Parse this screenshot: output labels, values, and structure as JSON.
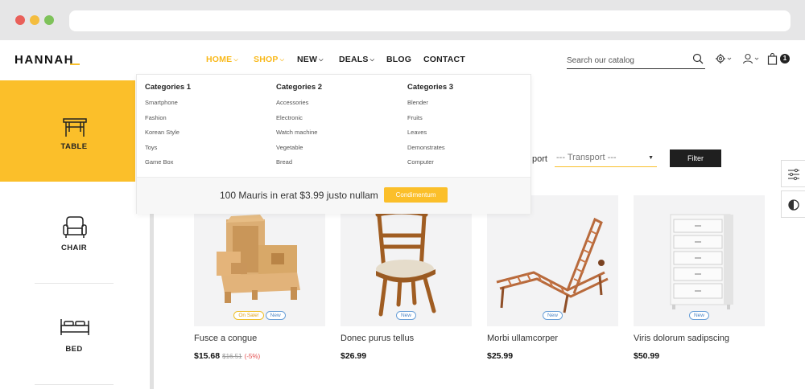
{
  "site": {
    "logo": "HANNAH"
  },
  "nav": [
    {
      "label": "HOME",
      "caret": true,
      "active": true
    },
    {
      "label": "SHOP",
      "caret": true,
      "active": true
    },
    {
      "label": "NEW",
      "caret": true,
      "active": false
    },
    {
      "label": "DEALS",
      "caret": true,
      "active": false
    },
    {
      "label": "BLOG",
      "caret": false,
      "active": false
    },
    {
      "label": "CONTACT",
      "caret": false,
      "active": false
    }
  ],
  "search": {
    "placeholder": "Search our catalog"
  },
  "cart": {
    "count": "1"
  },
  "sidebar": {
    "items": [
      {
        "label": "TABLE",
        "icon": "table-icon",
        "active": true
      },
      {
        "label": "CHAIR",
        "icon": "armchair-icon",
        "active": false
      },
      {
        "label": "BED",
        "icon": "bed-icon",
        "active": false
      }
    ]
  },
  "mega_menu": {
    "columns": [
      {
        "title": "Categories 1",
        "links": [
          "Smartphone",
          "Fashion",
          "Korean Style",
          "Toys",
          "Game Box"
        ]
      },
      {
        "title": "Categories 2",
        "links": [
          "Accessories",
          "Electronic",
          "Watch machine",
          "Vegetable",
          "Bread"
        ]
      },
      {
        "title": "Categories 3",
        "links": [
          "Blender",
          "Fruits",
          "Leaves",
          "Demonstrates",
          "Computer"
        ]
      }
    ],
    "promo_text": "100 Mauris in erat $3.99 justo nullam",
    "promo_button": "Condimentum"
  },
  "filter": {
    "label": "port",
    "select_value": "--- Transport ---",
    "button": "Filter"
  },
  "products": [
    {
      "name": "Fusce a congue",
      "price": "$15.68",
      "old_price": "$16.51",
      "discount": "(-5%)",
      "badges": [
        "On Sale!",
        "New"
      ],
      "image": "armchair"
    },
    {
      "name": "Donec purus tellus",
      "price": "$26.99",
      "old_price": "",
      "discount": "",
      "badges": [
        "New"
      ],
      "image": "chair"
    },
    {
      "name": "Morbi ullamcorper",
      "price": "$25.99",
      "old_price": "",
      "discount": "",
      "badges": [
        "New"
      ],
      "image": "lounger"
    },
    {
      "name": "Viris dolorum sadipscing",
      "price": "$50.99",
      "old_price": "",
      "discount": "",
      "badges": [
        "New"
      ],
      "image": "dresser"
    }
  ],
  "colors": {
    "accent": "#fbbf2a",
    "dark": "#1f1f1f",
    "sale_red": "#e34d4d",
    "new_blue": "#4d86c6"
  }
}
